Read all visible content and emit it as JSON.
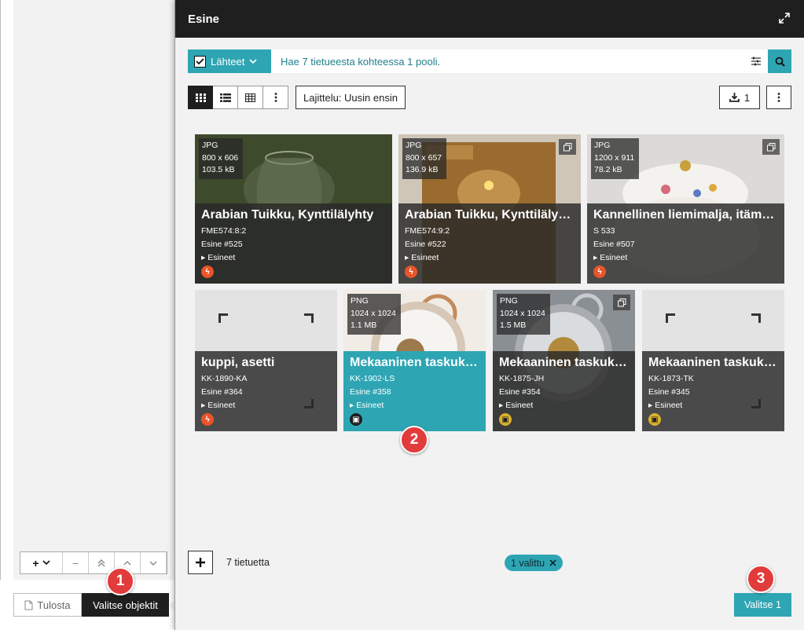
{
  "background": {
    "toolbar": {
      "add_label": "+",
      "buttons": [
        "−",
        "⇑",
        "^",
        "v"
      ]
    },
    "print_label": "Tulosta",
    "select_objects_label": "Valitse objektit"
  },
  "badges": [
    "1",
    "2",
    "3"
  ],
  "dialog": {
    "title": "Esine",
    "sources_label": "Lähteet",
    "search_placeholder": "Hae 7 tietueesta kohteessa 1 pooli.",
    "sort_label": "Lajittelu: Uusin ensin",
    "download_count": "1",
    "count_text": "7 tietuetta",
    "selected_chip": "1 valittu",
    "select_button": "Valitse 1"
  },
  "cards": [
    {
      "format": "JPG",
      "dims": "800 x 606",
      "size": "103.5 kB",
      "title": "Arabian Tuikku, Kynttilälyhty",
      "code": "FME574:8:2",
      "number": "Esine #525",
      "collection": "Esineet",
      "status": "red"
    },
    {
      "format": "JPG",
      "dims": "800 x 657",
      "size": "136.9 kB",
      "title": "Arabian Tuikku, Kynttilälyhty",
      "code": "FME574:9:2",
      "number": "Esine #522",
      "collection": "Esineet",
      "status": "red"
    },
    {
      "format": "JPG",
      "dims": "1200 x 911",
      "size": "78.2 kB",
      "title": "Kannellinen liemimalja, itämainen",
      "code": "S 533",
      "number": "Esine #507",
      "collection": "Esineet",
      "status": "red"
    },
    {
      "title": "kuppi, asetti",
      "code": "KK-1890-KA",
      "number": "Esine #364",
      "collection": "Esineet",
      "status": "red"
    },
    {
      "format": "PNG",
      "dims": "1024 x 1024",
      "size": "1.1 MB",
      "title": "Mekaaninen taskukello",
      "code": "KK-1902-LS",
      "number": "Esine #358",
      "collection": "Esineet",
      "status": "dark"
    },
    {
      "format": "PNG",
      "dims": "1024 x 1024",
      "size": "1.5 MB",
      "title": "Mekaaninen taskukello",
      "code": "KK-1875-JH",
      "number": "Esine #354",
      "collection": "Esineet",
      "status": "yellow"
    },
    {
      "title": "Mekaaninen taskukello",
      "code": "KK-1873-TK",
      "number": "Esine #345",
      "collection": "Esineet",
      "status": "yellow"
    }
  ],
  "colors": {
    "accent": "#2ea5b3",
    "header": "#1f1f1f",
    "badge": "#e23b3b"
  }
}
